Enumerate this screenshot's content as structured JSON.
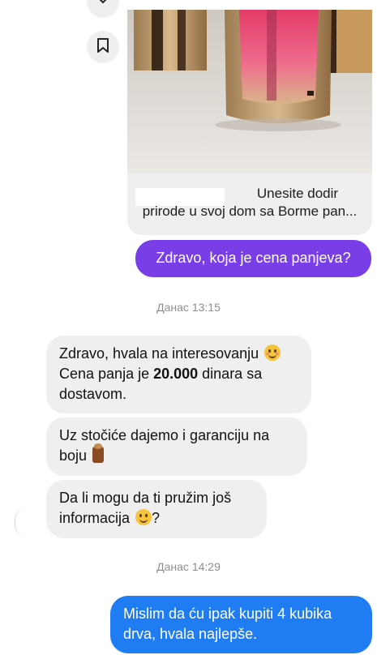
{
  "post": {
    "caption_line1": "Unesite dodir",
    "caption_line2": "prirode u svoj dom sa Borme pan..."
  },
  "messages": {
    "m1": "Zdravo, koja je cena panjeva?",
    "ts1": "Данас 13:15",
    "m2_line1": "Zdravo, hvala na interesovanju",
    "m2_line2_pre": "Cena panja je ",
    "m2_line2_bold": "20.000",
    "m2_line2_post": " dinara sa",
    "m2_line3": "dostavom.",
    "m3_line1": "Uz stočiće dajemo i garanciju na",
    "m3_line2": "boju",
    "m4_line1": "Da li mogu da ti pružim još",
    "m4_line2_pre": "informacija",
    "m4_line2_post": "?",
    "ts2": "Данас 14:29",
    "m5_line1": "Mislim da ću ipak kupiti 4 kubika",
    "m5_line2": "drva, hvala najlepše."
  },
  "colors": {
    "outgoing_purple": "#7a3ee8",
    "outgoing_blue": "#1f7cf2",
    "incoming_gray": "#efefef"
  },
  "icons": [
    "chevron-down-icon",
    "bookmark-icon",
    "smiling-face-icon",
    "wood-log-icon",
    "slightly-smiling-face-icon"
  ]
}
